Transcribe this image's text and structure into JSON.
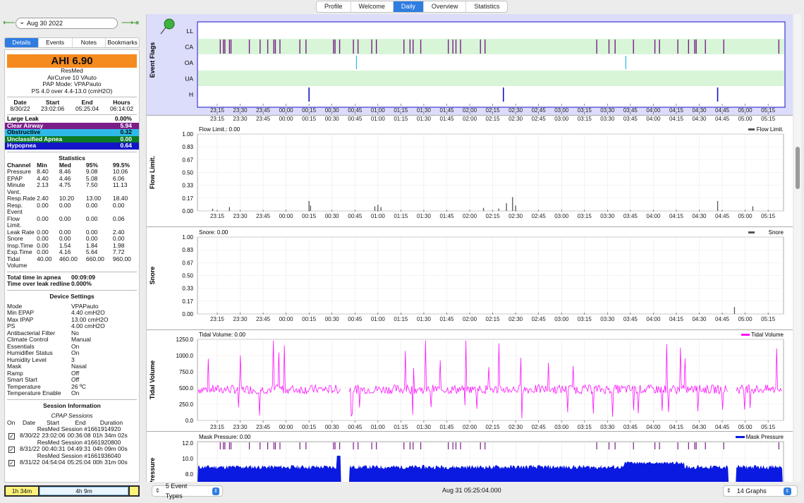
{
  "top_tabs": [
    "Profile",
    "Welcome",
    "Daily",
    "Overview",
    "Statistics"
  ],
  "active_top_tab": "Daily",
  "left": {
    "date": "Aug 30 2022",
    "tabs": [
      "Details",
      "Events",
      "Notes",
      "Bookmarks"
    ],
    "active_tab": "Details",
    "ahi": "AHI 6.90",
    "machine": [
      "ResMed",
      "AirCurve 10 VAuto",
      "PAP Mode: VPAPauto",
      "PS 4.0 over 4.4-13.0 (cmH2O)"
    ],
    "session_header": [
      "Date",
      "Start",
      "End",
      "Hours"
    ],
    "session_values": [
      "8/30/22",
      "23:02:06",
      "05:25:04",
      "06:14:02"
    ],
    "indices": [
      {
        "label": "Large Leak",
        "value": "0.00%",
        "bg": "#ffffff",
        "fg": "#000000"
      },
      {
        "label": "Clear Airway",
        "value": "5.94",
        "bg": "#7b1e88",
        "fg": "#ffffff"
      },
      {
        "label": "Obstructive",
        "value": "0.32",
        "bg": "#2fb9e8",
        "fg": "#000000"
      },
      {
        "label": "Unclassified Apnea",
        "value": "0.00",
        "bg": "#0a7a25",
        "fg": "#ffffff"
      },
      {
        "label": "Hypopnea",
        "value": "0.64",
        "bg": "#1414c8",
        "fg": "#ffffff"
      }
    ],
    "statistics_title": "Statistics",
    "stats_header": [
      "Channel",
      "Min",
      "Med",
      "95%",
      "99.5%"
    ],
    "stats_rows": [
      [
        "Pressure",
        "8.40",
        "8.46",
        "9.08",
        "10.06"
      ],
      [
        "EPAP",
        "4.40",
        "4.46",
        "5.08",
        "6.06"
      ],
      [
        "Minute Vent.",
        "2.13",
        "4.75",
        "7.50",
        "11.13"
      ],
      [
        "Resp.Rate",
        "2.40",
        "10.20",
        "13.00",
        "18.40"
      ],
      [
        "Resp. Event",
        "0.00",
        "0.00",
        "0.00",
        "0.00"
      ],
      [
        "Flow Limit.",
        "0.00",
        "0.00",
        "0.00",
        "0.06"
      ],
      [
        "Leak Rate",
        "0.00",
        "0.00",
        "0.00",
        "2.40"
      ],
      [
        "Snore",
        "0.00",
        "0.00",
        "0.00",
        "0.00"
      ],
      [
        "Insp.Time",
        "0.00",
        "1.54",
        "1.84",
        "1.98"
      ],
      [
        "Exp.Time",
        "0.00",
        "4.16",
        "5.64",
        "7.72"
      ],
      [
        "Tidal Volume",
        "40.00",
        "460.00",
        "660.00",
        "960.00"
      ]
    ],
    "apnea_time_label": "Total time in apnea",
    "apnea_time_value": "00:09:09",
    "leak_label": "Time over leak redline",
    "leak_value": "0.000%",
    "device_title": "Device Settings",
    "device_settings": [
      [
        "Mode",
        "VPAPauto"
      ],
      [
        "Min EPAP",
        "4.40 cmH2O"
      ],
      [
        "Max IPAP",
        "13.00 cmH2O"
      ],
      [
        "PS",
        "4.00 cmH2O"
      ],
      [
        "Antibacterial Filter",
        "No"
      ],
      [
        "Climate Control",
        "Manual"
      ],
      [
        "Essentials",
        "On"
      ],
      [
        "Humidifier Status",
        "On"
      ],
      [
        "Humidity Level",
        "3"
      ],
      [
        "Mask",
        "Nasal"
      ],
      [
        "Ramp",
        "Off"
      ],
      [
        "Smart Start",
        "Off"
      ],
      [
        "Temperature",
        "26 ºC"
      ],
      [
        "Temperature Enable",
        "On"
      ]
    ],
    "session_info_title": "Session Information",
    "cpap_sessions_title": "CPAP Sessions",
    "sessions_header": [
      "On",
      "Date",
      "Start",
      "End",
      "Duration"
    ],
    "sessions": [
      {
        "name": "ResMed Session #1661914920",
        "date": "8/30/22",
        "start": "23:02:06",
        "end": "00:36:08",
        "duration": "01h 34m 02s"
      },
      {
        "name": "ResMed Session #1661920800",
        "date": "8/31/22",
        "start": "00:40:31",
        "end": "04:49:31",
        "duration": "04h 09m 00s"
      },
      {
        "name": "ResMed Session #1661936040",
        "date": "8/31/22",
        "start": "04:54:04",
        "end": "05:25:04",
        "duration": "00h 31m 00s"
      }
    ],
    "bottom_bars": [
      "1h 34m",
      "4h 9m"
    ]
  },
  "status": {
    "event_types": "5 Event Types",
    "time": "Aug 31 05:25:04.000",
    "graphs": "14 Graphs"
  },
  "time_ticks": [
    "23:15",
    "23:30",
    "23:45",
    "00:00",
    "00:15",
    "00:30",
    "00:45",
    "01:00",
    "01:15",
    "01:30",
    "01:45",
    "02:00",
    "02:15",
    "02:30",
    "02:45",
    "03:00",
    "03:15",
    "03:30",
    "03:45",
    "04:00",
    "04:15",
    "04:30",
    "04:45",
    "05:00",
    "05:15"
  ],
  "colors": {
    "ca": "#7b1e88",
    "oa": "#2fb9e8",
    "h": "#1414c8",
    "ca_band": "#d8f5d8",
    "flags_bg": "#dcdcfb",
    "tidal": "#ff10ff",
    "pressure": "#0a1ae0",
    "grey_bar": "#555555"
  },
  "chart_data": [
    {
      "type": "timeline",
      "ylabel": "Event Flags",
      "rows": [
        "LL",
        "CA",
        "OA",
        "UA",
        "H"
      ],
      "x_range": [
        "23:02",
        "05:25"
      ],
      "events": {
        "CA": [
          "23:17",
          "23:19",
          "23:20",
          "23:23",
          "23:24",
          "23:36",
          "23:43",
          "23:48",
          "23:52",
          "23:53",
          "23:56",
          "00:09",
          "00:13",
          "00:31",
          "00:32",
          "00:35",
          "00:44",
          "00:47",
          "00:56",
          "00:59",
          "01:17",
          "01:21",
          "01:23",
          "01:28",
          "01:46",
          "01:49",
          "01:51",
          "01:54",
          "02:07",
          "02:10",
          "03:23",
          "03:31",
          "03:35",
          "03:47",
          "04:01",
          "04:04",
          "04:16",
          "04:23",
          "04:27",
          "04:28",
          "04:34",
          "04:46",
          "05:22"
        ],
        "OA": [
          "00:46",
          "03:42"
        ],
        "H": [
          "00:15",
          "02:22",
          "04:42"
        ]
      }
    },
    {
      "type": "bar",
      "title": "Flow Limit.: 0.00",
      "legend": "Flow Limit.",
      "ylabel": "Flow Limit.",
      "ylim": [
        0,
        1.0
      ],
      "yticks": [
        "0.00",
        "0.17",
        "0.33",
        "0.50",
        "0.67",
        "0.83",
        "1.00"
      ],
      "points": [
        [
          "23:12",
          0.03
        ],
        [
          "23:23",
          0.05
        ],
        [
          "00:15",
          0.13
        ],
        [
          "00:16",
          0.07
        ],
        [
          "00:58",
          0.06
        ],
        [
          "01:00",
          0.08
        ],
        [
          "01:02",
          0.05
        ],
        [
          "02:09",
          0.04
        ],
        [
          "02:19",
          0.03
        ],
        [
          "02:24",
          0.1
        ],
        [
          "02:28",
          0.18
        ],
        [
          "02:30",
          0.07
        ],
        [
          "04:42",
          0.13
        ],
        [
          "05:05",
          0.06
        ]
      ]
    },
    {
      "type": "bar",
      "title": "Snore: 0.00",
      "legend": "Snore",
      "ylabel": "Snore",
      "ylim": [
        0,
        1.0
      ],
      "yticks": [
        "0.00",
        "0.17",
        "0.33",
        "0.50",
        "0.67",
        "0.83",
        "1.00"
      ],
      "points": [
        [
          "04:53",
          0.09
        ]
      ]
    },
    {
      "type": "line",
      "title": "Tidal Volume: 0.00",
      "legend": "Tidal Volume",
      "ylabel": "Tidal Volume",
      "ylim": [
        0,
        1250
      ],
      "yticks": [
        "0.0",
        "250.0",
        "500.0",
        "750.0",
        "1000.0",
        "1250.0"
      ],
      "baseline": 480
    },
    {
      "type": "area",
      "title": "Mask Pressure: 0.00",
      "legend": "Mask Pressure",
      "ylabel": "Pressure",
      "yticks": [
        "8.0",
        "10.0",
        "12.0"
      ],
      "baseline": 8.6
    }
  ]
}
